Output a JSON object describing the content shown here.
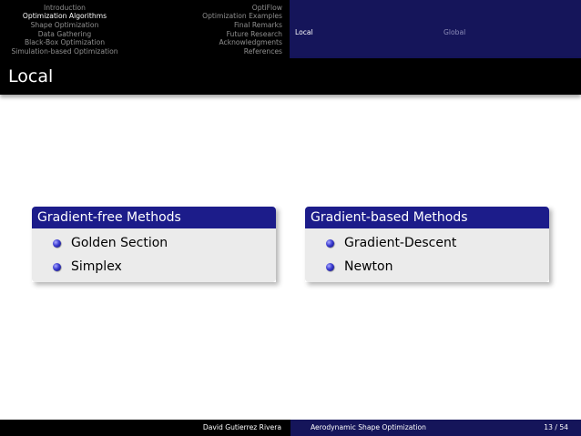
{
  "nav": {
    "sections": [
      "Introduction",
      "Optimization Algorithms",
      "Shape Optimization",
      "Data Gathering",
      "Black-Box Optimization",
      "Simulation-based Optimization"
    ],
    "sections_right": [
      "OptiFlow",
      "Optimization Examples",
      "Final Remarks",
      "Future Research",
      "Acknowledgments",
      "References"
    ],
    "subsections": [
      "Local",
      "Global"
    ]
  },
  "frame_title": "Local",
  "blocks": [
    {
      "title": "Gradient-free Methods",
      "items": [
        "Golden Section",
        "Simplex"
      ]
    },
    {
      "title": "Gradient-based Methods",
      "items": [
        "Gradient-Descent",
        "Newton"
      ]
    }
  ],
  "footer": {
    "author": "David Gutierrez Rivera",
    "presentation_title": "Aerodynamic Shape Optimization",
    "page": "13 / 54"
  }
}
